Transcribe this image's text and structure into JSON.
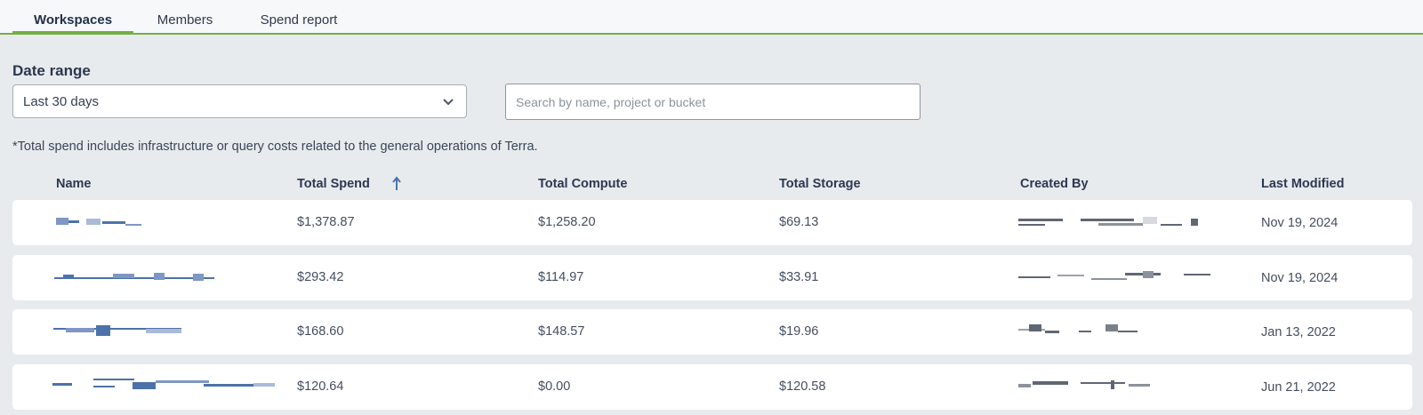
{
  "tabs": [
    {
      "label": "Workspaces",
      "active": true
    },
    {
      "label": "Members",
      "active": false
    },
    {
      "label": "Spend report",
      "active": false
    }
  ],
  "filters": {
    "date_range_label": "Date range",
    "date_range_value": "Last 30 days",
    "search_placeholder": "Search by name, project or bucket"
  },
  "note": "*Total spend includes infrastructure or query costs related to the general operations of Terra.",
  "table": {
    "columns": [
      "Name",
      "Total Spend",
      "Total Compute",
      "Total Storage",
      "Created By",
      "Last Modified"
    ],
    "sorted_by": "Total Spend",
    "rows": [
      {
        "total_spend": "$1,378.87",
        "total_compute": "$1,258.20",
        "total_storage": "$69.13",
        "last_modified": "Nov 19, 2024"
      },
      {
        "total_spend": "$293.42",
        "total_compute": "$114.97",
        "total_storage": "$33.91",
        "last_modified": "Nov 19, 2024"
      },
      {
        "total_spend": "$168.60",
        "total_compute": "$148.57",
        "total_storage": "$19.96",
        "last_modified": "Jan 13, 2022"
      },
      {
        "total_spend": "$120.64",
        "total_compute": "$0.00",
        "total_storage": "$120.58",
        "last_modified": "Jun 21, 2022"
      }
    ]
  },
  "colors": {
    "accent": "#74ae43",
    "link": "#4d72aa",
    "background": "#e8ebee"
  }
}
